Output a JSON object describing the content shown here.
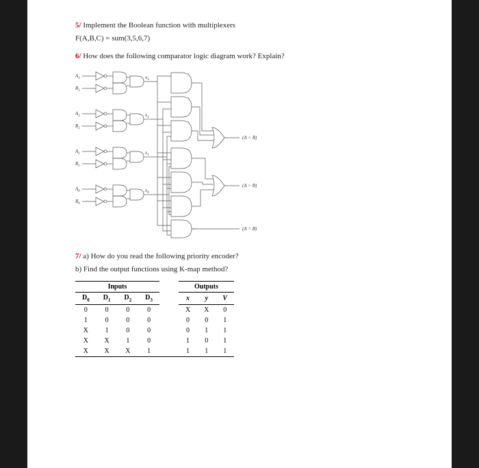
{
  "q5": {
    "num": "5/",
    "text": "Implement the Boolean function with multiplexers",
    "func": "F(A,B,C) = sum(3,5,6,7)"
  },
  "q6": {
    "num": "6/",
    "text": "How does the following comparator logic diagram work? Explain?"
  },
  "diagram": {
    "inputs": [
      {
        "a": "A",
        "ai": "3",
        "b": "B",
        "bi": "3",
        "x": "x",
        "xi": "3"
      },
      {
        "a": "A",
        "ai": "2",
        "b": "B",
        "bi": "2",
        "x": "x",
        "xi": "2"
      },
      {
        "a": "A",
        "ai": "1",
        "b": "B",
        "bi": "1",
        "x": "x",
        "xi": "1"
      },
      {
        "a": "A",
        "ai": "0",
        "b": "B",
        "bi": "0",
        "x": "x",
        "xi": "0"
      }
    ],
    "out_lt": "(A < B)",
    "out_gt": "(A > B)",
    "out_eq": "(A = B)"
  },
  "q7": {
    "num": "7/",
    "a": "a) How do you read the following priority encoder?",
    "b": "b) Find the output functions using K-map method?"
  },
  "table": {
    "group_in": "Inputs",
    "group_out": "Outputs",
    "cols_in": [
      "D",
      "D",
      "D",
      "D"
    ],
    "cols_in_sub": [
      "0",
      "1",
      "2",
      "3"
    ],
    "cols_out": [
      "x",
      "y",
      "V"
    ],
    "rows": [
      [
        "0",
        "0",
        "0",
        "0",
        "X",
        "X",
        "0"
      ],
      [
        "1",
        "0",
        "0",
        "0",
        "0",
        "0",
        "1"
      ],
      [
        "X",
        "1",
        "0",
        "0",
        "0",
        "1",
        "1"
      ],
      [
        "X",
        "X",
        "1",
        "0",
        "1",
        "0",
        "1"
      ],
      [
        "X",
        "X",
        "X",
        "1",
        "1",
        "1",
        "1"
      ]
    ]
  }
}
